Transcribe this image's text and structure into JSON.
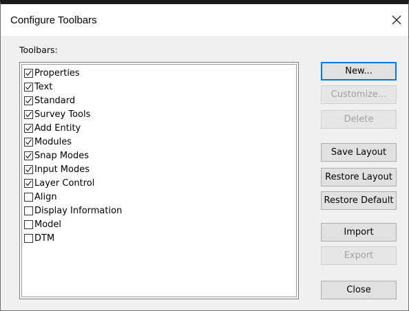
{
  "window": {
    "title": "Configure Toolbars",
    "close_glyph": "✕"
  },
  "toolbars": {
    "label": "Toolbars:",
    "items": [
      {
        "label": "Properties",
        "checked": true
      },
      {
        "label": "Text",
        "checked": true
      },
      {
        "label": "Standard",
        "checked": true
      },
      {
        "label": "Survey Tools",
        "checked": true
      },
      {
        "label": "Add Entity",
        "checked": true
      },
      {
        "label": "Modules",
        "checked": true
      },
      {
        "label": "Snap Modes",
        "checked": true
      },
      {
        "label": "Input Modes",
        "checked": true
      },
      {
        "label": "Layer Control",
        "checked": true
      },
      {
        "label": "Align",
        "checked": false
      },
      {
        "label": "Display Information",
        "checked": false
      },
      {
        "label": "Model",
        "checked": false
      },
      {
        "label": "DTM",
        "checked": false
      }
    ]
  },
  "buttons": {
    "new": "New...",
    "customize": "Customize...",
    "delete": "Delete",
    "save_layout": "Save Layout",
    "restore_layout": "Restore Layout",
    "restore_default": "Restore Default",
    "import": "Import",
    "export": "Export",
    "close": "Close"
  },
  "colors": {
    "default_button_border": "#0078d7",
    "disabled_text": "#a0a0a0"
  }
}
